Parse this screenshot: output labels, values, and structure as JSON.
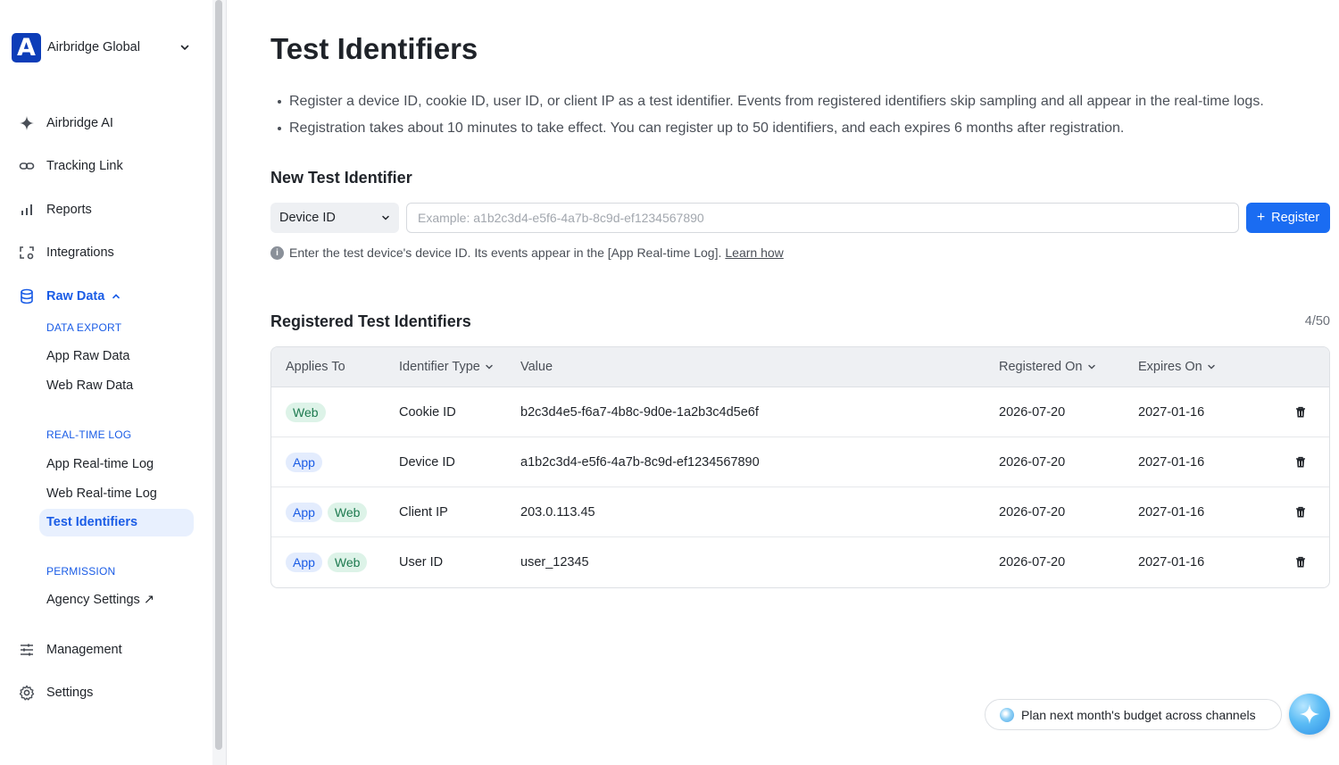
{
  "sidebar": {
    "org": {
      "logo_letter": "A",
      "name": "Airbridge Global"
    },
    "items": [
      {
        "label": "Airbridge AI",
        "icon": "sparkle-icon"
      },
      {
        "label": "Tracking Link",
        "icon": "link-icon"
      },
      {
        "label": "Reports",
        "icon": "bar-chart-icon"
      },
      {
        "label": "Integrations",
        "icon": "integrations-icon"
      },
      {
        "label": "Raw Data",
        "icon": "database-icon",
        "expanded": true
      },
      {
        "label": "Management",
        "icon": "sliders-icon"
      },
      {
        "label": "Settings",
        "icon": "gear-icon"
      }
    ],
    "sections": {
      "data_export": "DATA EXPORT",
      "real_time_log": "REAL-TIME LOG",
      "permission": "PERMISSION"
    },
    "sub_items": {
      "app_raw_data": "App Raw Data",
      "web_raw_data": "Web Raw Data",
      "app_real_time_log": "App Real-time Log",
      "web_real_time_log": "Web Real-time Log",
      "test_identifiers": "Test Identifiers",
      "agency_settings": "Agency Settings ↗"
    }
  },
  "main": {
    "title": "Test Identifiers",
    "bullets": [
      "Register a device ID, cookie ID, user ID, or client IP as a test identifier. Events from registered identifiers skip sampling and all appear in the real-time logs.",
      "Registration takes about 10 minutes to take effect. You can register up to 50 identifiers, and each expires 6 months after registration."
    ],
    "new_section_title": "New Test Identifier",
    "form": {
      "type_selected": "Device ID",
      "input_value": "",
      "input_placeholder": "Example: a1b2c3d4-e5f6-4a7b-8c9d-ef1234567890",
      "register_label": "Register",
      "register_plus": "+"
    },
    "hint": {
      "text": "Enter the test device's device ID. Its events appear in the [App Real-time Log].",
      "link": "Learn how"
    },
    "registered_section_title": "Registered Test Identifiers",
    "count": "4/50",
    "table": {
      "headers": {
        "applies_to": "Applies To",
        "identifier_type": "Identifier Type",
        "value": "Value",
        "registered_on": "Registered On",
        "expires_on": "Expires On"
      },
      "rows": [
        {
          "applies": [
            "Web"
          ],
          "type": "Cookie ID",
          "value": "b2c3d4e5-f6a7-4b8c-9d0e-1a2b3c4d5e6f",
          "registered": "2026-07-20",
          "expires": "2027-01-16"
        },
        {
          "applies": [
            "App"
          ],
          "type": "Device ID",
          "value": "a1b2c3d4-e5f6-4a7b-8c9d-ef1234567890",
          "registered": "2026-07-20",
          "expires": "2027-01-16"
        },
        {
          "applies": [
            "App",
            "Web"
          ],
          "type": "Client IP",
          "value": "203.0.113.45",
          "registered": "2026-07-20",
          "expires": "2027-01-16"
        },
        {
          "applies": [
            "App",
            "Web"
          ],
          "type": "User ID",
          "value": "user_12345",
          "registered": "2026-07-20",
          "expires": "2027-01-16"
        }
      ]
    }
  },
  "assistant": {
    "suggestion": "Plan next month's budget across channels"
  },
  "colors": {
    "brand": "#0d3db8",
    "accent": "#1a6cf2",
    "active_text": "#1a5ce6",
    "badge_app_bg": "#e3ecfd",
    "badge_web_bg": "#ddf3e8"
  }
}
